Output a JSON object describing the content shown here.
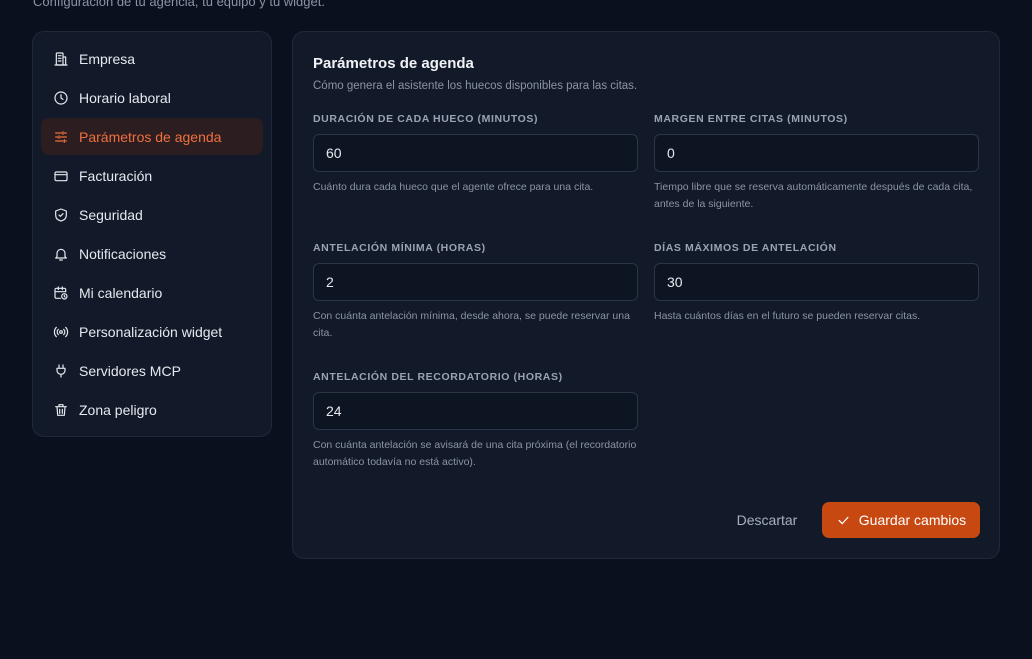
{
  "header": {
    "subtitle": "Configuración de tu agencia, tu equipo y tu widget."
  },
  "sidebar": {
    "items": [
      {
        "label": "Empresa",
        "icon": "building-icon"
      },
      {
        "label": "Horario laboral",
        "icon": "clock-icon"
      },
      {
        "label": "Parámetros de agenda",
        "icon": "sliders-icon",
        "active": true
      },
      {
        "label": "Facturación",
        "icon": "credit-card-icon"
      },
      {
        "label": "Seguridad",
        "icon": "shield-check-icon"
      },
      {
        "label": "Notificaciones",
        "icon": "bell-icon"
      },
      {
        "label": "Mi calendario",
        "icon": "calendar-clock-icon"
      },
      {
        "label": "Personalización widget",
        "icon": "radio-icon"
      },
      {
        "label": "Servidores MCP",
        "icon": "plug-icon"
      },
      {
        "label": "Zona peligro",
        "icon": "trash-icon"
      }
    ]
  },
  "panel": {
    "title": "Parámetros de agenda",
    "description": "Cómo genera el asistente los huecos disponibles para las citas.",
    "fields": {
      "slot_duration": {
        "label": "DURACIÓN DE CADA HUECO (MINUTOS)",
        "value": "60",
        "help": "Cuánto dura cada hueco que el agente ofrece para una cita."
      },
      "buffer": {
        "label": "MARGEN ENTRE CITAS (MINUTOS)",
        "value": "0",
        "help": "Tiempo libre que se reserva automáticamente después de cada cita, antes de la siguiente."
      },
      "min_notice": {
        "label": "ANTELACIÓN MÍNIMA (HORAS)",
        "value": "2",
        "help": "Con cuánta antelación mínima, desde ahora, se puede reservar una cita."
      },
      "max_days": {
        "label": "DÍAS MÁXIMOS DE ANTELACIÓN",
        "value": "30",
        "help": "Hasta cuántos días en el futuro se pueden reservar citas."
      },
      "reminder": {
        "label": "ANTELACIÓN DEL RECORDATORIO (HORAS)",
        "value": "24",
        "help": "Con cuánta antelación se avisará de una cita próxima (el recordatorio automático todavía no está activo)."
      }
    },
    "actions": {
      "discard_label": "Descartar",
      "save_label": "Guardar cambios",
      "save_icon": "check-icon"
    }
  },
  "colors": {
    "background": "#0a101d",
    "card": "#121a29",
    "accent": "#c84812",
    "active_text": "#f0703f"
  }
}
